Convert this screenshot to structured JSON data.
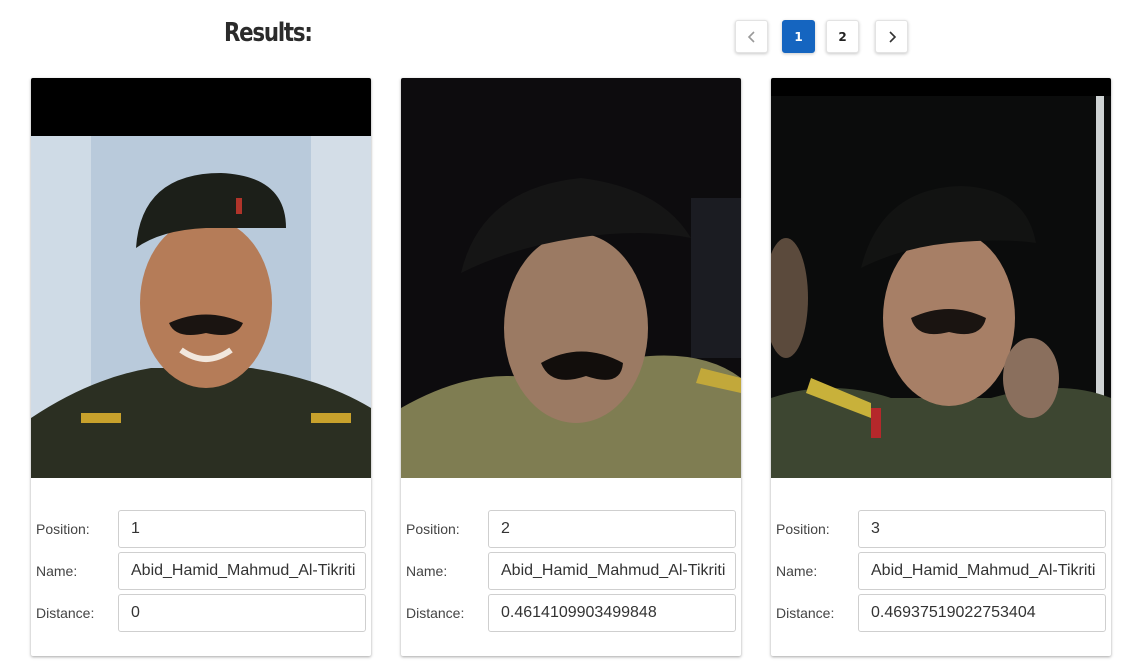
{
  "header": {
    "title": "Results:"
  },
  "pagination": {
    "prev_icon": "chevron-left-icon",
    "next_icon": "chevron-right-icon",
    "pages": [
      "1",
      "2"
    ],
    "current": "1",
    "active_color": "#1565c0"
  },
  "labels": {
    "position": "Position:",
    "name": "Name:",
    "distance": "Distance:"
  },
  "results": [
    {
      "position": "1",
      "name": "Abid_Hamid_Mahmud_Al-Tikriti",
      "distance": "0"
    },
    {
      "position": "2",
      "name": "Abid_Hamid_Mahmud_Al-Tikriti",
      "distance": "0.4614109903499848"
    },
    {
      "position": "3",
      "name": "Abid_Hamid_Mahmud_Al-Tikriti",
      "distance": "0.46937519022753404"
    }
  ]
}
